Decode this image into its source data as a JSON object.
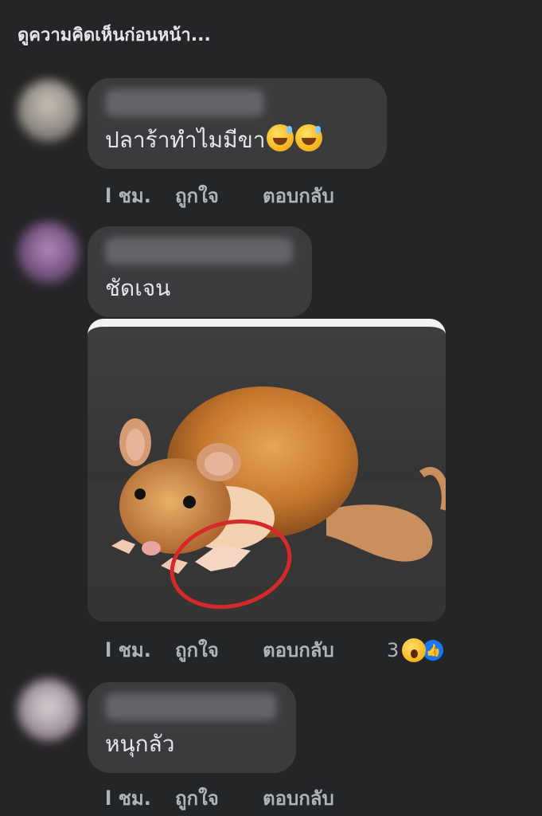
{
  "header": {
    "view_previous": "ดูความคิดเห็นก่อนหน้า..."
  },
  "comments": [
    {
      "text": "ปลาร้าทำไมมีขา",
      "emoji": [
        "grinning-sweat-emoji",
        "grinning-sweat-emoji"
      ],
      "time": "l ชม.",
      "like": "ถูกใจ",
      "reply": "ตอบกลับ"
    },
    {
      "text": "ชัดเจน",
      "time": "l ชม.",
      "like": "ถูกใจ",
      "reply": "ตอบกลับ",
      "reactions": {
        "count": "3",
        "icons": [
          "wow-icon",
          "like-icon"
        ]
      }
    },
    {
      "text": "หนุกลัว",
      "time": "l ชม.",
      "like": "ถูกใจ",
      "reply": "ตอบกลับ"
    }
  ],
  "colors": {
    "background": "#242526",
    "bubble": "#3a3b3c",
    "text": "#e4e6eb",
    "secondary_text": "#b0b3b8",
    "like_blue": "#1877f2",
    "circle_red": "#d62a2a"
  }
}
